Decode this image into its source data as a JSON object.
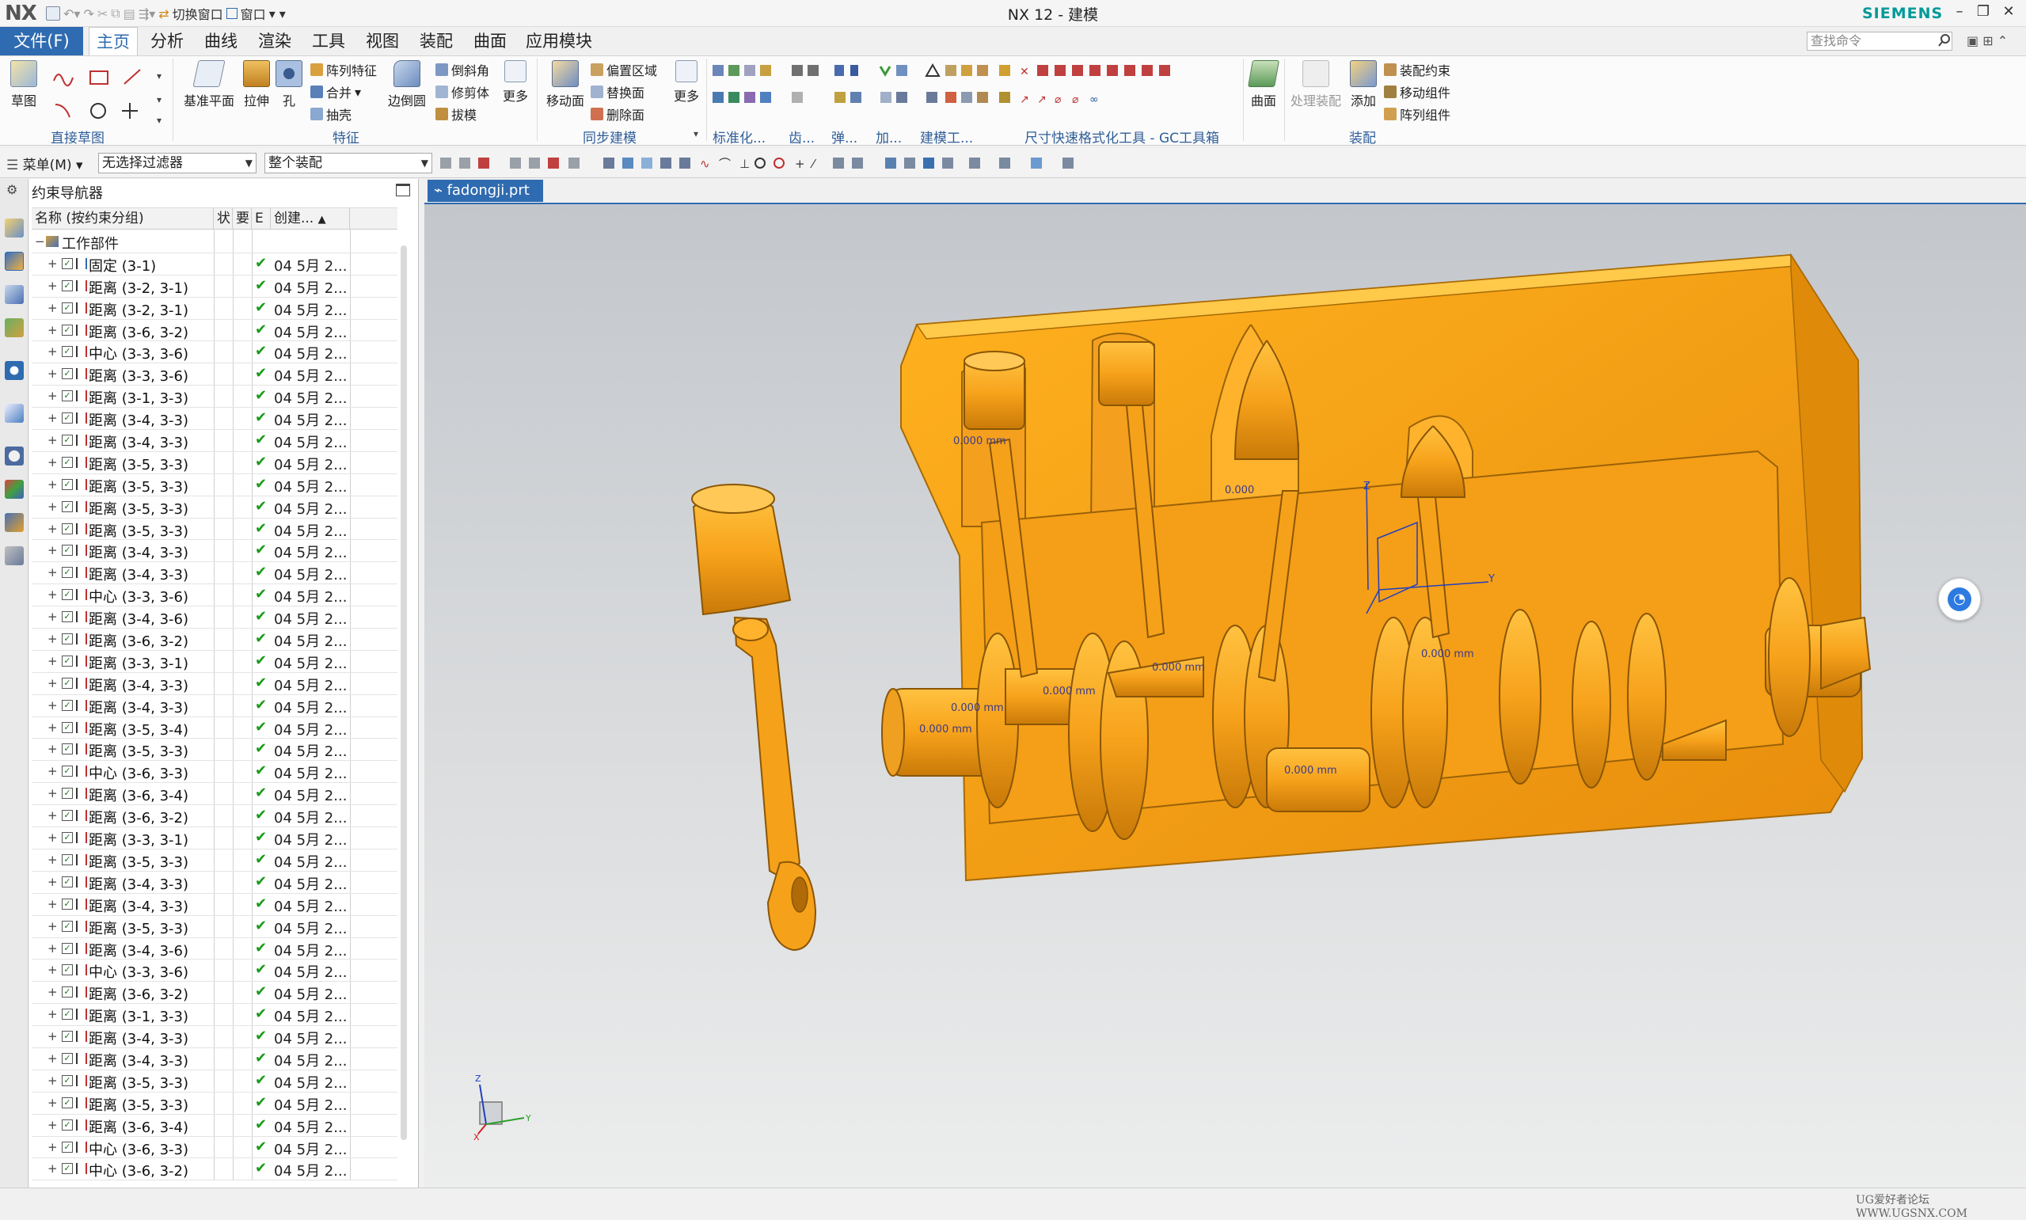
{
  "window": {
    "app_title": "NX 12 - 建模",
    "brand": "SIEMENS",
    "switch_window": "切换窗口",
    "window_menu": "窗口"
  },
  "menu_tabs": {
    "file": "文件(F)",
    "home": "主页",
    "analysis": "分析",
    "curve": "曲线",
    "render": "渲染",
    "tools": "工具",
    "view": "视图",
    "assembly": "装配",
    "surface": "曲面",
    "app_module": "应用模块"
  },
  "search_placeholder": "查找命令",
  "ribbon": {
    "sketch": "草图",
    "direct_sketch_group": "直接草图",
    "datum_plane": "基准平面",
    "extrude": "拉伸",
    "hole": "孔",
    "pattern_feature": "阵列特征",
    "unite": "合并",
    "shell": "抽壳",
    "edge_blend": "边倒圆",
    "chamfer": "倒斜角",
    "trim_body": "修剪体",
    "draft": "拔模",
    "more": "更多",
    "feature_group": "特征",
    "move_face": "移动面",
    "offset_region": "偏置区域",
    "replace_face": "替换面",
    "delete_face": "删除面",
    "more2": "更多",
    "sync_group": "同步建模",
    "standardize": "标准化...",
    "gear": "齿...",
    "spring": "弹...",
    "machining": "加...",
    "modeling_tools": "建模工...",
    "dim_tools": "尺寸快速格式化工具 - GC工具箱",
    "surface_btn": "曲面",
    "process_assembly": "处理装配",
    "add": "添加",
    "assembly_constraint": "装配约束",
    "move_component": "移动组件",
    "pattern_component": "阵列组件",
    "assembly_group": "装配"
  },
  "toolbar": {
    "menu": "菜单(M)",
    "filter": "无选择过滤器",
    "scope": "整个装配"
  },
  "navigator": {
    "title": "约束导航器",
    "col_name": "名称 (按约束分组)",
    "col_a": "状",
    "col_b": "要",
    "col_c": "E",
    "col_created": "创建...",
    "root": "工作部件",
    "rows": [
      {
        "label": "固定 (3-1)",
        "type": "fix",
        "date": "04 5月 2..."
      },
      {
        "label": "距离 (3-2, 3-1)",
        "type": "dist",
        "date": "04 5月 2..."
      },
      {
        "label": "距离 (3-2, 3-1)",
        "type": "dist",
        "date": "04 5月 2..."
      },
      {
        "label": "距离 (3-6, 3-2)",
        "type": "dist",
        "date": "04 5月 2..."
      },
      {
        "label": "中心 (3-3, 3-6)",
        "type": "center",
        "date": "04 5月 2..."
      },
      {
        "label": "距离 (3-3, 3-6)",
        "type": "dist",
        "date": "04 5月 2..."
      },
      {
        "label": "距离 (3-1, 3-3)",
        "type": "dist",
        "date": "04 5月 2..."
      },
      {
        "label": "距离 (3-4, 3-3)",
        "type": "dist",
        "date": "04 5月 2..."
      },
      {
        "label": "距离 (3-4, 3-3)",
        "type": "dist",
        "date": "04 5月 2..."
      },
      {
        "label": "距离 (3-5, 3-3)",
        "type": "dist",
        "date": "04 5月 2..."
      },
      {
        "label": "距离 (3-5, 3-3)",
        "type": "dist",
        "date": "04 5月 2..."
      },
      {
        "label": "距离 (3-5, 3-3)",
        "type": "dist",
        "date": "04 5月 2..."
      },
      {
        "label": "距离 (3-5, 3-3)",
        "type": "dist",
        "date": "04 5月 2..."
      },
      {
        "label": "距离 (3-4, 3-3)",
        "type": "dist",
        "date": "04 5月 2..."
      },
      {
        "label": "距离 (3-4, 3-3)",
        "type": "dist",
        "date": "04 5月 2..."
      },
      {
        "label": "中心 (3-3, 3-6)",
        "type": "center",
        "date": "04 5月 2..."
      },
      {
        "label": "距离 (3-4, 3-6)",
        "type": "dist",
        "date": "04 5月 2..."
      },
      {
        "label": "距离 (3-6, 3-2)",
        "type": "dist",
        "date": "04 5月 2..."
      },
      {
        "label": "距离 (3-3, 3-1)",
        "type": "dist",
        "date": "04 5月 2..."
      },
      {
        "label": "距离 (3-4, 3-3)",
        "type": "dist",
        "date": "04 5月 2..."
      },
      {
        "label": "距离 (3-4, 3-3)",
        "type": "dist",
        "date": "04 5月 2..."
      },
      {
        "label": "距离 (3-5, 3-4)",
        "type": "dist",
        "date": "04 5月 2..."
      },
      {
        "label": "距离 (3-5, 3-3)",
        "type": "dist",
        "date": "04 5月 2..."
      },
      {
        "label": "中心 (3-6, 3-3)",
        "type": "center",
        "date": "04 5月 2..."
      },
      {
        "label": "距离 (3-6, 3-4)",
        "type": "dist",
        "date": "04 5月 2..."
      },
      {
        "label": "距离 (3-6, 3-2)",
        "type": "dist",
        "date": "04 5月 2..."
      },
      {
        "label": "距离 (3-3, 3-1)",
        "type": "dist",
        "date": "04 5月 2..."
      },
      {
        "label": "距离 (3-5, 3-3)",
        "type": "dist",
        "date": "04 5月 2..."
      },
      {
        "label": "距离 (3-4, 3-3)",
        "type": "dist",
        "date": "04 5月 2..."
      },
      {
        "label": "距离 (3-4, 3-3)",
        "type": "dist",
        "date": "04 5月 2..."
      },
      {
        "label": "距离 (3-5, 3-3)",
        "type": "dist",
        "date": "04 5月 2..."
      },
      {
        "label": "距离 (3-4, 3-6)",
        "type": "dist",
        "date": "04 5月 2..."
      },
      {
        "label": "中心 (3-3, 3-6)",
        "type": "center",
        "date": "04 5月 2..."
      },
      {
        "label": "距离 (3-6, 3-2)",
        "type": "dist",
        "date": "04 5月 2..."
      },
      {
        "label": "距离 (3-1, 3-3)",
        "type": "dist",
        "date": "04 5月 2..."
      },
      {
        "label": "距离 (3-4, 3-3)",
        "type": "dist",
        "date": "04 5月 2..."
      },
      {
        "label": "距离 (3-4, 3-3)",
        "type": "dist",
        "date": "04 5月 2..."
      },
      {
        "label": "距离 (3-5, 3-3)",
        "type": "dist",
        "date": "04 5月 2..."
      },
      {
        "label": "距离 (3-5, 3-3)",
        "type": "dist",
        "date": "04 5月 2..."
      },
      {
        "label": "距离 (3-6, 3-4)",
        "type": "dist",
        "date": "04 5月 2..."
      },
      {
        "label": "中心 (3-6, 3-3)",
        "type": "center",
        "date": "04 5月 2..."
      },
      {
        "label": "中心 (3-6, 3-2)",
        "type": "center",
        "date": "04 5月 2..."
      }
    ]
  },
  "graphics": {
    "doc_tab": "fadongji.prt",
    "dim_label": "0.000 mm",
    "dim_label_short": "0.000",
    "axis_x": "X",
    "axis_y": "Y",
    "axis_z": "Z"
  },
  "watermark": "UG爱好者论坛 WWW.UGSNX.COM",
  "colors": {
    "part": "#F7A21B",
    "accent": "#2f6bb0",
    "brand": "#009999"
  }
}
